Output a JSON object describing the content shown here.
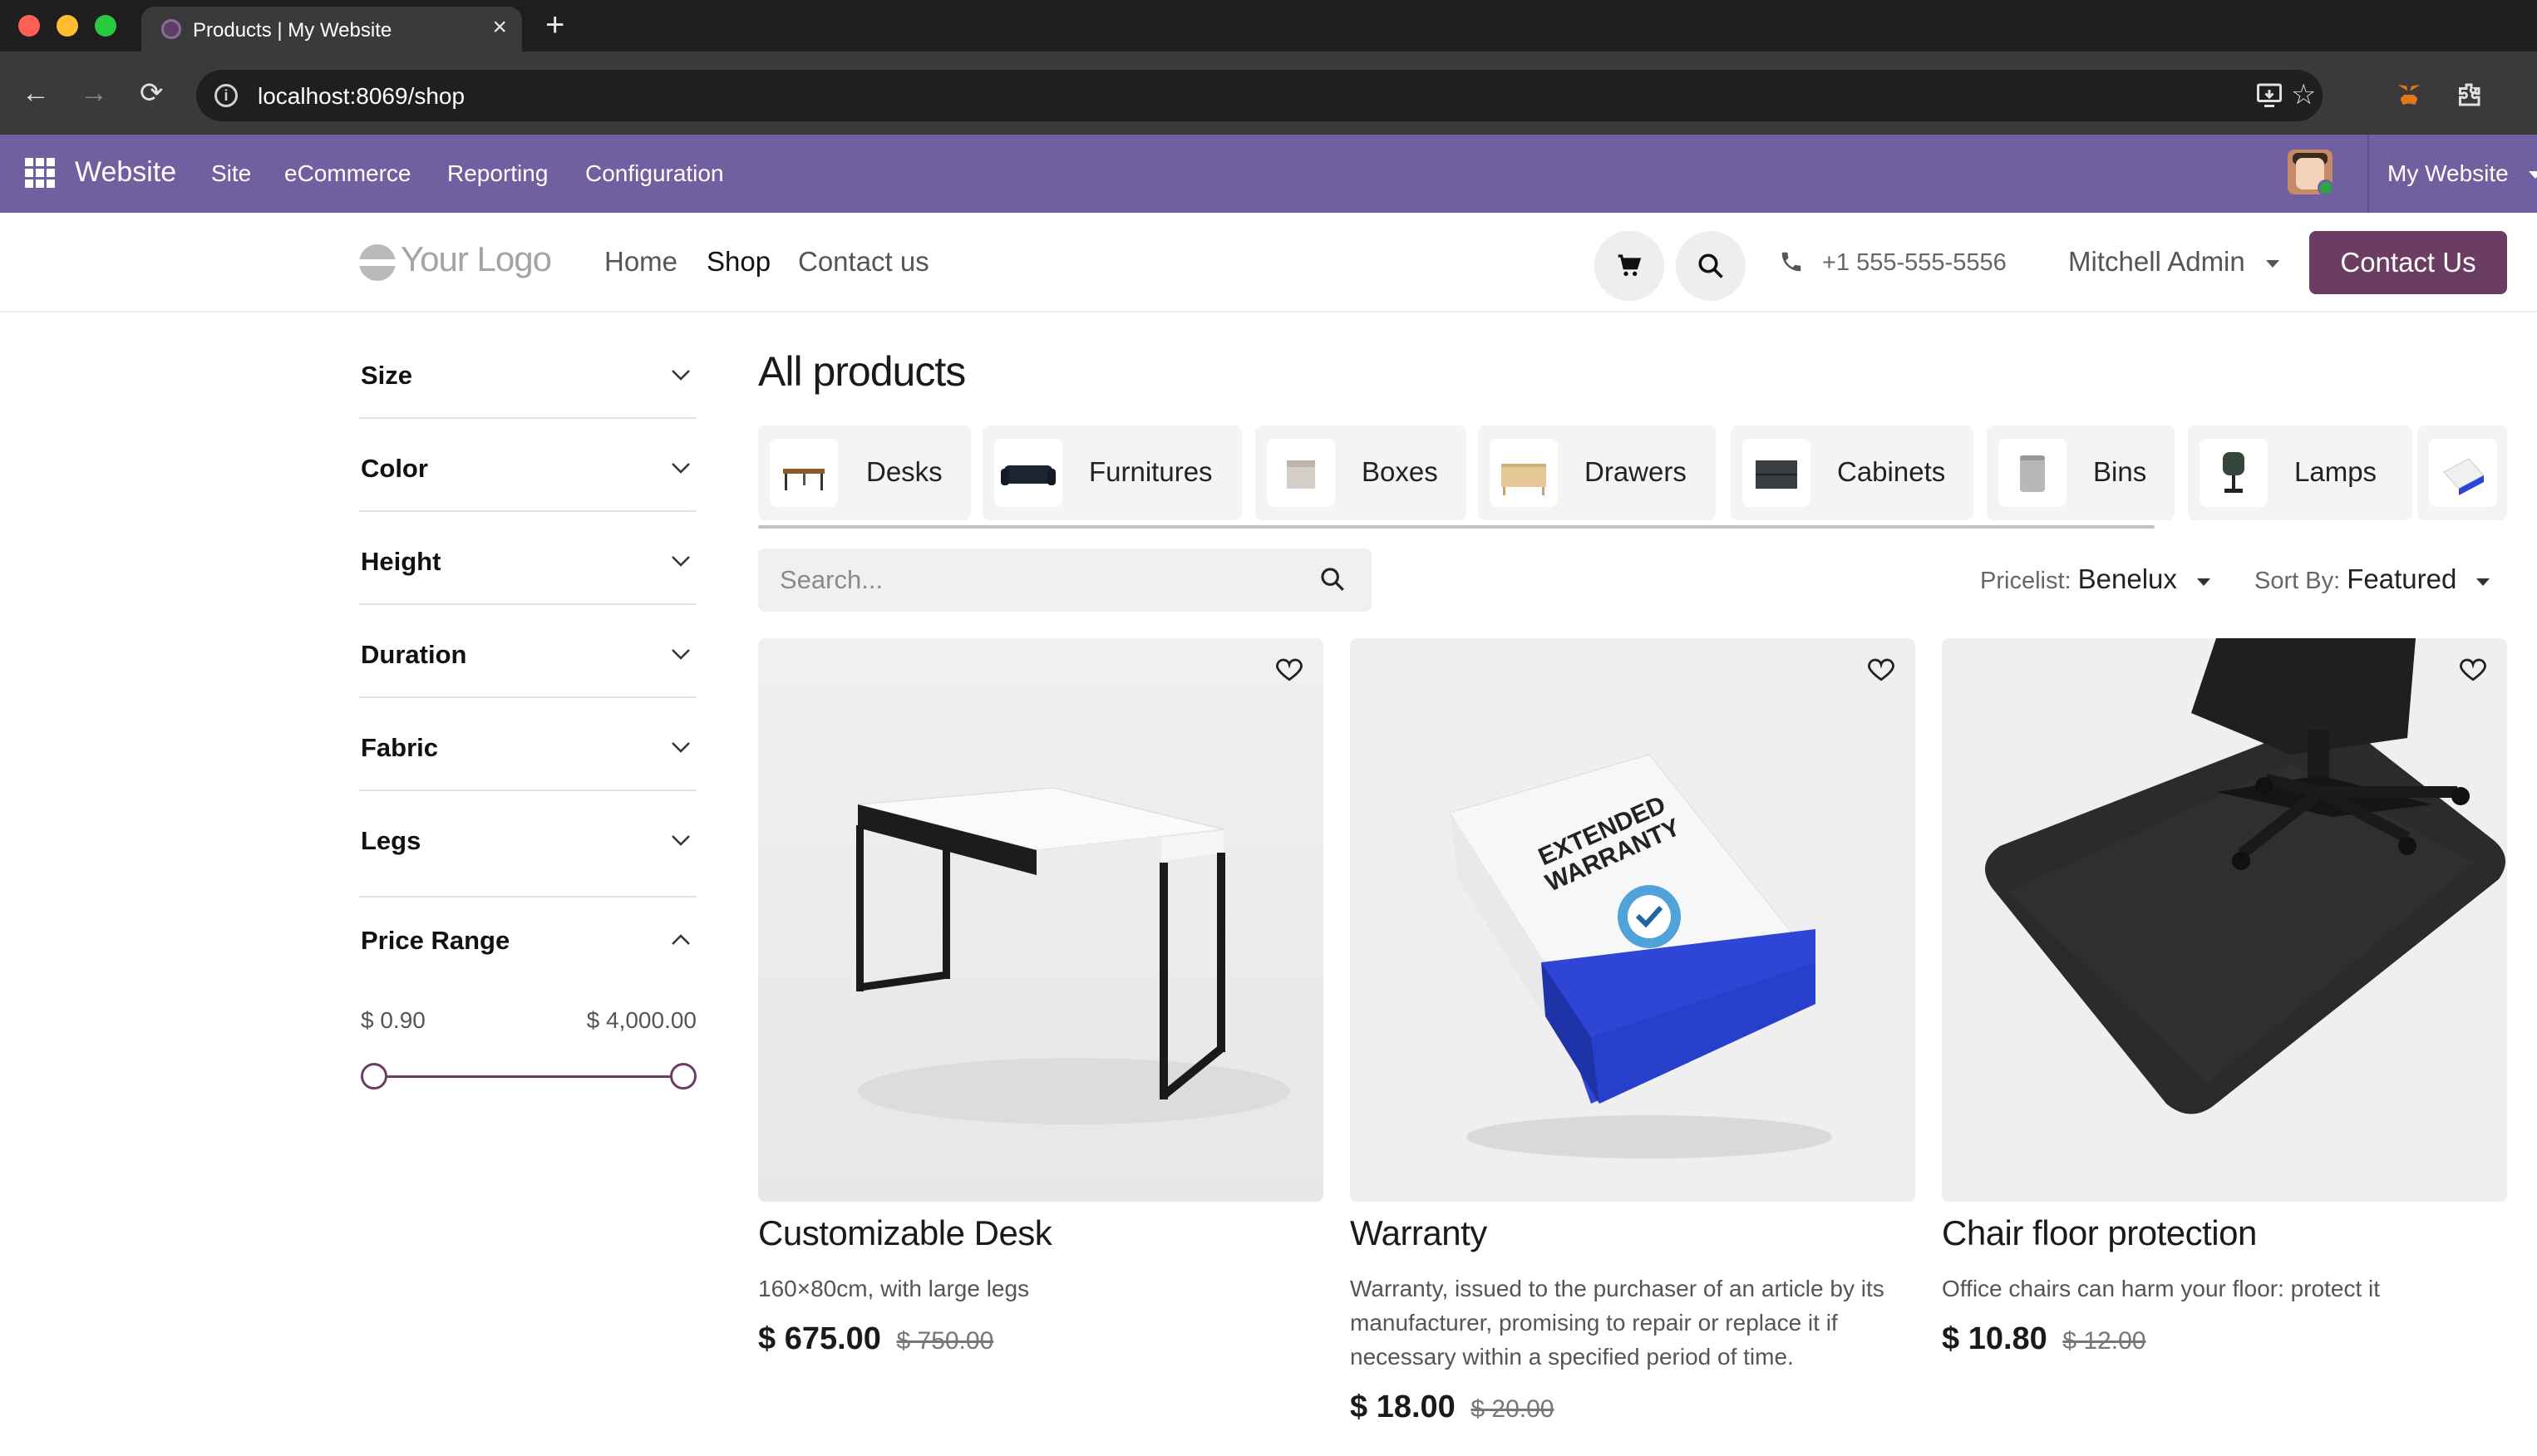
{
  "browser": {
    "tab_title": "Products | My Website",
    "url": "localhost:8069/shop"
  },
  "odoo_bar": {
    "app_name": "Website",
    "menus": [
      "Site",
      "eCommerce",
      "Reporting",
      "Configuration"
    ],
    "website_switcher": "My Website"
  },
  "header": {
    "logo": "Your Logo",
    "nav": [
      "Home",
      "Shop",
      "Contact us"
    ],
    "active_nav": "Shop",
    "phone": "+1 555-555-5556",
    "user": "Mitchell Admin",
    "cta": "Contact Us"
  },
  "filters": {
    "items": [
      "Size",
      "Color",
      "Height",
      "Duration",
      "Fabric",
      "Legs",
      "Price Range"
    ],
    "price_range": {
      "min_label": "$ 0.90",
      "max_label": "$ 4,000.00"
    }
  },
  "main": {
    "title": "All products",
    "categories": [
      "Desks",
      "Furnitures",
      "Boxes",
      "Drawers",
      "Cabinets",
      "Bins",
      "Lamps"
    ],
    "search_placeholder": "Search...",
    "pricelist_label": "Pricelist:",
    "pricelist_value": "Benelux",
    "sort_label": "Sort By:",
    "sort_value": "Featured"
  },
  "products": [
    {
      "name": "Customizable Desk",
      "description": "160×80cm, with large legs",
      "price": "$ 675.00",
      "old_price": "$ 750.00"
    },
    {
      "name": "Warranty",
      "description": "Warranty, issued to the purchaser of an article by its manufacturer, promising to repair or replace it if necessary within a specified period of time.",
      "price": "$ 18.00",
      "old_price": "$ 20.00",
      "box_text": "EXTENDED WARRANTY"
    },
    {
      "name": "Chair floor protection",
      "description": "Office chairs can harm your floor: protect it",
      "price": "$ 10.80",
      "old_price": "$ 12.00"
    }
  ],
  "colors": {
    "odoo_purple": "#7160a0",
    "brand_plum": "#6b3d62",
    "chrome_dark": "#1e1e1f"
  }
}
